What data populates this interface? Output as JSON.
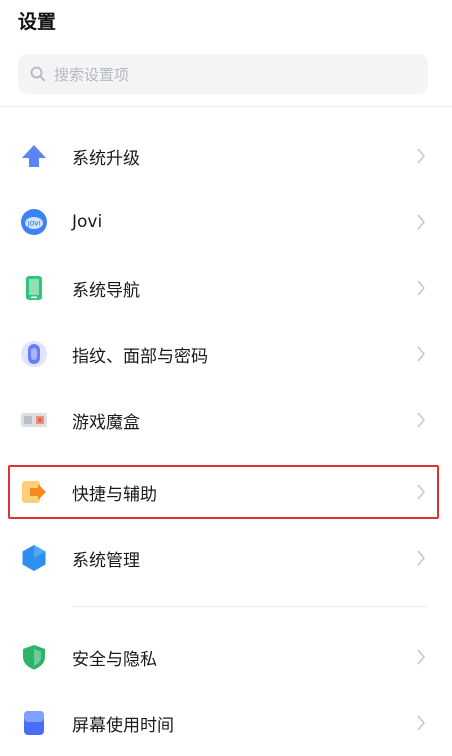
{
  "header": {
    "title": "设置"
  },
  "search": {
    "placeholder": "搜索设置项",
    "icon": "search-icon"
  },
  "items": [
    {
      "label": "系统升级",
      "icon": "upgrade-arrow-icon",
      "color": "#4f7bf7"
    },
    {
      "label": "Jovi",
      "icon": "jovi-icon",
      "color": "#3b82f6"
    },
    {
      "label": "系统导航",
      "icon": "phone-navigation-icon",
      "color": "#34c37a"
    },
    {
      "label": "指纹、面部与密码",
      "icon": "fingerprint-icon",
      "color": "#6a7df5"
    },
    {
      "label": "游戏魔盒",
      "icon": "game-box-icon",
      "color": "#c9cdd3"
    },
    {
      "label": "快捷与辅助",
      "icon": "shortcut-icon",
      "color": "#f5a623"
    },
    {
      "label": "系统管理",
      "icon": "system-management-icon",
      "color": "#2f8ff0"
    },
    {
      "label": "安全与隐私",
      "icon": "security-shield-icon",
      "color": "#2fb36c"
    },
    {
      "label": "屏幕使用时间",
      "icon": "screen-time-icon",
      "color": "#4a6cf7"
    }
  ],
  "highlight": {
    "item_index": 5,
    "color": "#e03030"
  }
}
